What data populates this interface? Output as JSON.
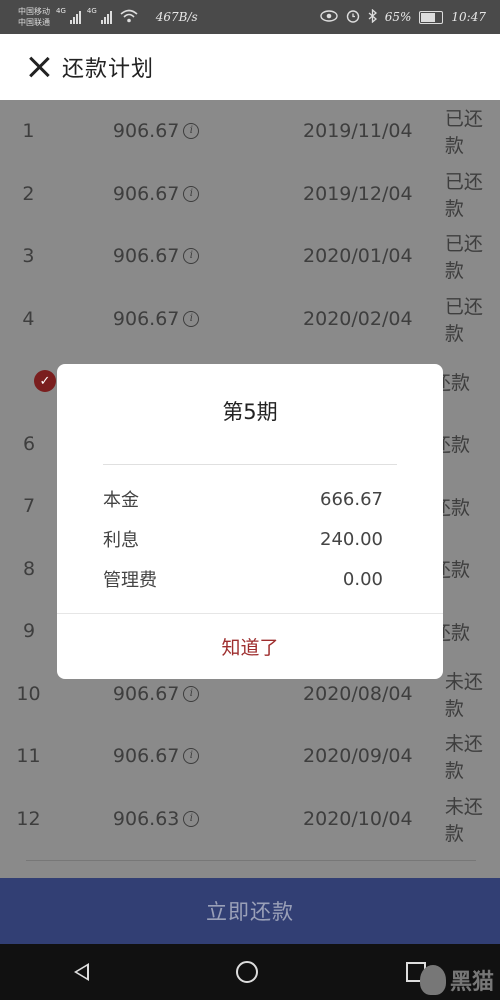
{
  "status_bar": {
    "carrier_1": "中国移动",
    "carrier_2": "中国联通",
    "net_1": "4G",
    "net_2": "4G",
    "speed": "467B/s",
    "battery": "65%",
    "time": "10:47"
  },
  "header": {
    "title": "还款计划"
  },
  "rows": [
    {
      "no": "1",
      "amount": "906.67",
      "date": "2019/11/04",
      "status": "已还款"
    },
    {
      "no": "2",
      "amount": "906.67",
      "date": "2019/12/04",
      "status": "已还款"
    },
    {
      "no": "3",
      "amount": "906.67",
      "date": "2020/01/04",
      "status": "已还款"
    },
    {
      "no": "4",
      "amount": "906.67",
      "date": "2020/02/04",
      "status": "已还款"
    },
    {
      "no": "",
      "amount": "",
      "date": "",
      "status": "还款"
    },
    {
      "no": "6",
      "amount": "",
      "date": "",
      "status": "还款"
    },
    {
      "no": "7",
      "amount": "",
      "date": "",
      "status": "还款"
    },
    {
      "no": "8",
      "amount": "",
      "date": "",
      "status": "还款"
    },
    {
      "no": "9",
      "amount": "",
      "date": "",
      "status": "还款"
    },
    {
      "no": "10",
      "amount": "906.67",
      "date": "2020/08/04",
      "status": "未还款"
    },
    {
      "no": "11",
      "amount": "906.67",
      "date": "2020/09/04",
      "status": "未还款"
    },
    {
      "no": "12",
      "amount": "906.63",
      "date": "2020/10/04",
      "status": "未还款"
    }
  ],
  "info_glyph": "i",
  "check_glyph": "✓",
  "pay_button": "立即还款",
  "modal": {
    "title": "第5期",
    "items": [
      {
        "label": "本金",
        "value": "666.67"
      },
      {
        "label": "利息",
        "value": "240.00"
      },
      {
        "label": "管理费",
        "value": "0.00"
      }
    ],
    "confirm": "知道了"
  },
  "watermark": "黑猫",
  "colors": {
    "overlay_gray": "#8a8a8a",
    "pay_bar": "#323f74",
    "accent_red": "#9e2e2e",
    "check_badge": "#7a1e1e"
  }
}
